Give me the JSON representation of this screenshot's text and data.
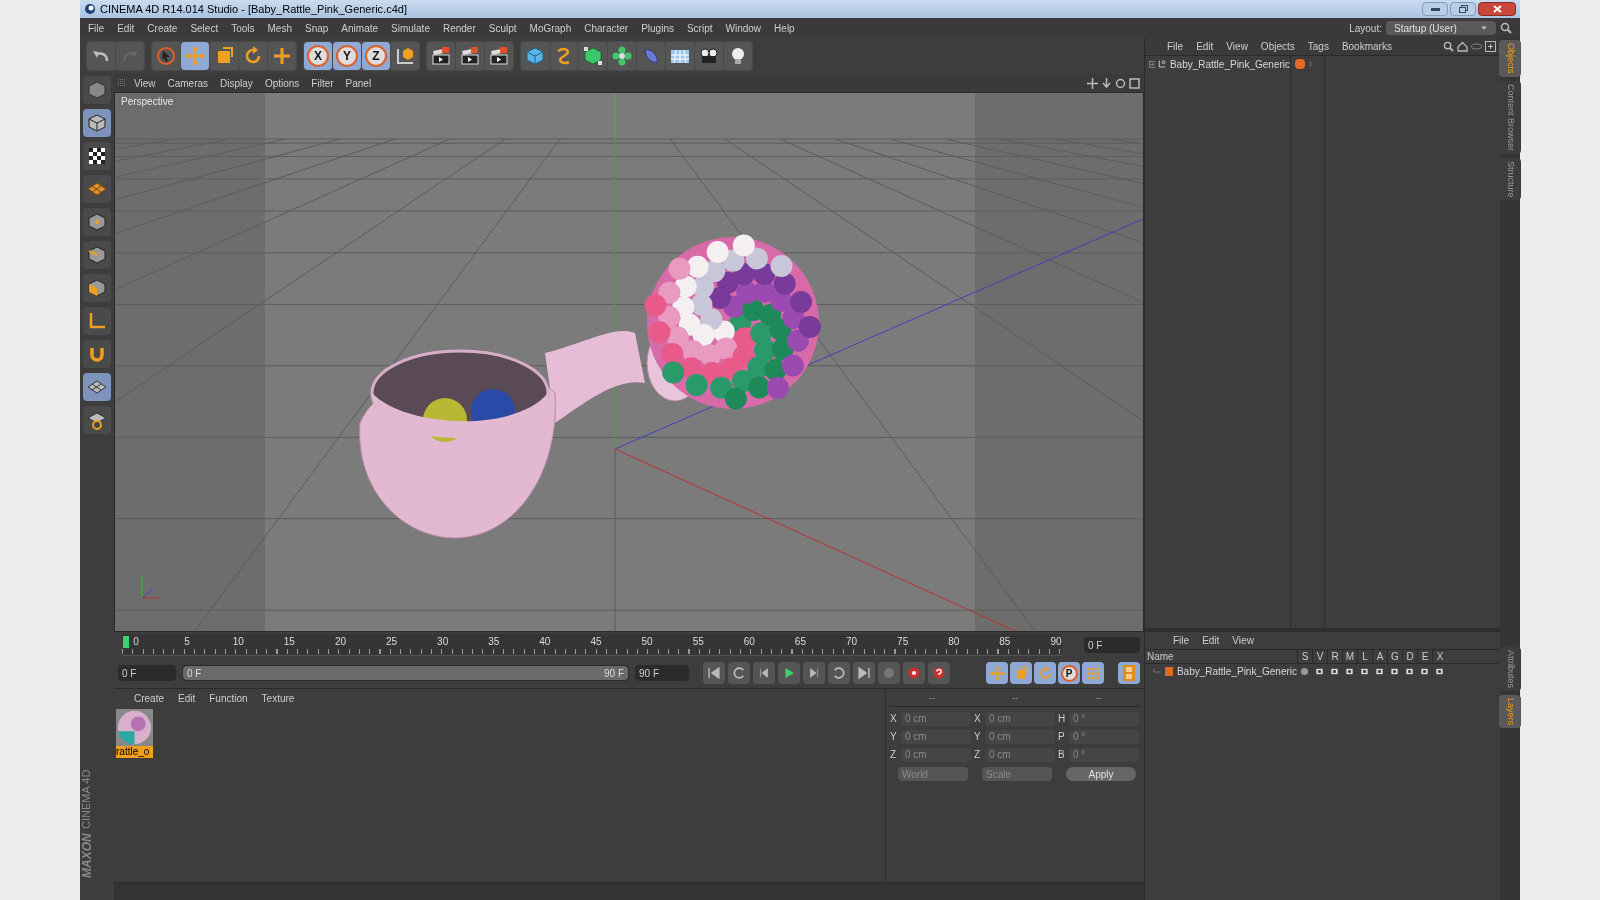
{
  "window": {
    "title": "CINEMA 4D R14.014 Studio - [Baby_Rattle_Pink_Generic.c4d]"
  },
  "menu": [
    "File",
    "Edit",
    "Create",
    "Select",
    "Tools",
    "Mesh",
    "Snap",
    "Animate",
    "Simulate",
    "Render",
    "Sculpt",
    "MoGraph",
    "Character",
    "Plugins",
    "Script",
    "Window",
    "Help"
  ],
  "layout": {
    "label": "Layout:",
    "value": "Startup (User)"
  },
  "main_toolbar": [
    {
      "kind": "undo",
      "selected": false
    },
    {
      "kind": "redo",
      "selected": false
    },
    {
      "kind": "select",
      "selected": false
    },
    {
      "kind": "move",
      "selected": true
    },
    {
      "kind": "scale",
      "selected": false
    },
    {
      "kind": "rotate",
      "selected": false
    },
    {
      "kind": "add",
      "selected": false
    },
    {
      "kind": "axis",
      "label": "X",
      "selected": true
    },
    {
      "kind": "axis",
      "label": "Y",
      "selected": true
    },
    {
      "kind": "axis",
      "label": "Z",
      "selected": true
    },
    {
      "kind": "coords",
      "selected": false
    },
    {
      "kind": "render",
      "selected": false
    },
    {
      "kind": "render",
      "selected": false
    },
    {
      "kind": "render",
      "selected": false
    },
    {
      "kind": "cube",
      "selected": false
    },
    {
      "kind": "spline",
      "selected": false
    },
    {
      "kind": "nurbs",
      "selected": false
    },
    {
      "kind": "array",
      "selected": false
    },
    {
      "kind": "deformer",
      "selected": false
    },
    {
      "kind": "floor",
      "selected": false
    },
    {
      "kind": "camera",
      "selected": false
    },
    {
      "kind": "light",
      "selected": false
    }
  ],
  "left_palette": [
    {
      "selected": false
    },
    {
      "selected": true
    },
    {
      "selected": false
    },
    {
      "selected": false
    },
    {
      "selected": false
    },
    {
      "selected": false
    },
    {
      "selected": false
    },
    {
      "selected": false
    },
    {
      "selected": false
    },
    {
      "selected": true
    },
    {
      "selected": false
    }
  ],
  "viewport": {
    "menu": [
      "View",
      "Cameras",
      "Display",
      "Options",
      "Filter",
      "Panel"
    ],
    "label": "Perspective"
  },
  "timeline": {
    "ticks": [
      "0",
      "5",
      "10",
      "15",
      "20",
      "25",
      "30",
      "35",
      "40",
      "45",
      "50",
      "55",
      "60",
      "65",
      "70",
      "75",
      "80",
      "85",
      "90"
    ],
    "current_frame": "0 F",
    "start_field": "0 F",
    "range_slider": {
      "level": 1
    },
    "range_start": "0 F",
    "range_end": "90 F",
    "end_field": "90 F"
  },
  "key_buttons": [
    {
      "kind": "move",
      "selected": true
    },
    {
      "kind": "scale",
      "selected": true
    },
    {
      "kind": "rotate",
      "selected": true
    },
    {
      "kind": "param",
      "label": "P",
      "selected": true
    },
    {
      "kind": "points",
      "selected": true
    }
  ],
  "materials": {
    "menu": [
      "Create",
      "Edit",
      "Function",
      "Texture"
    ],
    "items": [
      {
        "name": "rattle_o",
        "selected": true
      }
    ]
  },
  "coordinates": {
    "headers": [
      "--",
      "--",
      "--"
    ],
    "rows": [
      {
        "pos_axis": "X",
        "pos": "0 cm",
        "size_axis": "X",
        "size": "0 cm",
        "rot_axis": "H",
        "rot": "0 °"
      },
      {
        "pos_axis": "Y",
        "pos": "0 cm",
        "size_axis": "Y",
        "size": "0 cm",
        "rot_axis": "P",
        "rot": "0 °"
      },
      {
        "pos_axis": "Z",
        "pos": "0 cm",
        "size_axis": "Z",
        "size": "0 cm",
        "rot_axis": "B",
        "rot": "0 °"
      }
    ],
    "space": "World",
    "mode": "Scale",
    "apply": "Apply"
  },
  "objects": {
    "menu": [
      "File",
      "Edit",
      "View",
      "Objects",
      "Tags",
      "Bookmarks"
    ],
    "items": [
      {
        "name": "Baby_Rattle_Pink_Generic",
        "color": "#e06a20"
      }
    ]
  },
  "layers": {
    "menu": [
      "File",
      "Edit",
      "View"
    ],
    "columns": [
      "Name",
      "S",
      "V",
      "R",
      "M",
      "L",
      "A",
      "G",
      "D",
      "E",
      "X"
    ],
    "rows": [
      {
        "name": "Baby_Rattle_Pink_Generic",
        "color": "#e06a20"
      }
    ]
  },
  "side_tabs_top": [
    {
      "label": "Objects",
      "selected": true
    },
    {
      "label": "Content Browser",
      "selected": false
    },
    {
      "label": "Structure",
      "selected": false
    }
  ],
  "side_tabs_bottom": [
    {
      "label": "Attributes",
      "selected": false
    },
    {
      "label": "Layers",
      "selected": true
    }
  ],
  "brand": {
    "maker": "MAXON",
    "product": "CINEMA 4D"
  }
}
